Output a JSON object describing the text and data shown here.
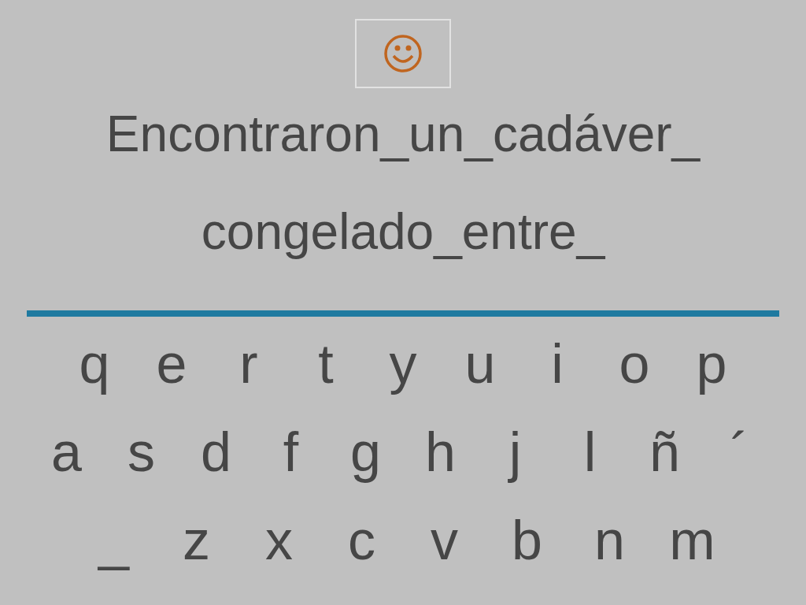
{
  "prompt_lines": [
    "Encontraron_un_cadáver_",
    "congelado_entre_"
  ],
  "keyboard_rows": [
    [
      "q",
      "e",
      "r",
      "t",
      "y",
      "u",
      "i",
      "o",
      "p"
    ],
    [
      "a",
      "s",
      "d",
      "f",
      "g",
      "h",
      "j",
      "l",
      "ñ",
      "´"
    ],
    [
      "_",
      "z",
      "x",
      "c",
      "v",
      "b",
      "n",
      "m"
    ]
  ]
}
